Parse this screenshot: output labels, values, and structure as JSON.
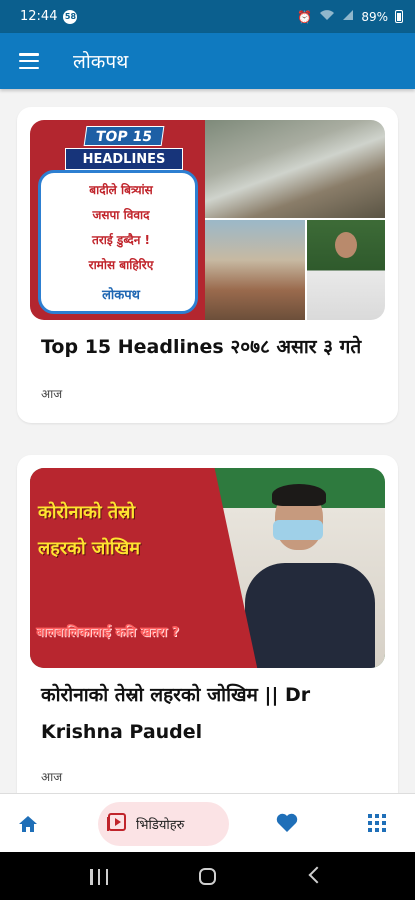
{
  "status_bar": {
    "time": "12:44",
    "notification_badge": "58",
    "battery": "89%",
    "icons": [
      "alarm-icon",
      "wifi-icon",
      "signal-icon",
      "battery-icon"
    ]
  },
  "app_bar": {
    "title": "लोकपथ",
    "menu_icon": "hamburger-menu-icon"
  },
  "feed": [
    {
      "title": "Top 15 Headlines २०७८ असार ३ गते",
      "date": "आज",
      "thumbnail": {
        "badge_top": "TOP 15",
        "badge_bottom": "HEADLINES",
        "lines": [
          "बादीले बित्र्यांस",
          "जसपा विवाद",
          "तराई डुब्दैन !",
          "रामोस बाहिरिए"
        ],
        "logo": "लोकपथ"
      }
    },
    {
      "title": "कोरोनाको तेस्रो लहरको जोखिम || Dr Krishna Paudel",
      "date": "आज",
      "thumbnail": {
        "line1": "कोरोनाको तेस्रो",
        "line2": "लहरको जोखिम",
        "line3": "बालबालिकालाई कति खतरा ?"
      }
    }
  ],
  "bottom_nav": {
    "home_icon": "home-icon",
    "videos_label": "भिडियोहरु",
    "videos_icon": "video-icon",
    "favorites_icon": "heart-icon",
    "more_icon": "grid-icon"
  },
  "colors": {
    "status_bar": "#0b5f8e",
    "app_bar": "#0f7ac0",
    "accent": "#1f6fb8",
    "video_pill": "#fbe3e5"
  }
}
